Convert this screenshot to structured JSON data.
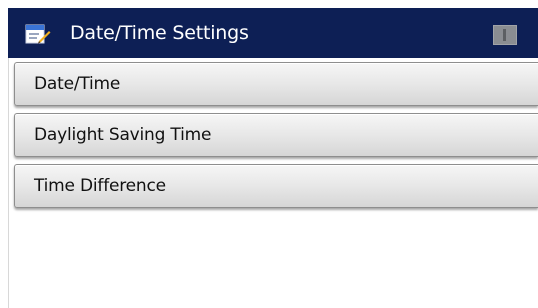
{
  "header": {
    "title": "Date/Time Settings",
    "icon": "settings-clipboard-icon",
    "status_icon": "battery-icon",
    "background_color": "#0d1f55"
  },
  "menu": {
    "items": [
      {
        "label": "Date/Time"
      },
      {
        "label": "Daylight Saving Time"
      },
      {
        "label": "Time Difference"
      }
    ]
  }
}
